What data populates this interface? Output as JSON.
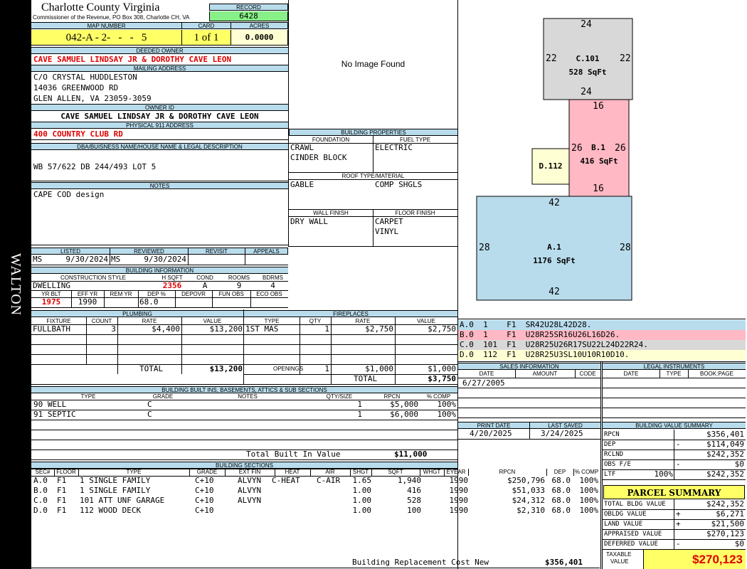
{
  "side_label": "WALTON",
  "header": {
    "county": "Charlotte County Virginia",
    "commissioner": "Commissioner of the Revenue, PO Box 308, Charlotte CH, VA",
    "record_label": "RECORD",
    "record": "6428"
  },
  "parcel": {
    "map_label": "MAP NUMBER",
    "map": "042-A - 2-   -   -   5",
    "card_label": "CARD",
    "card": "1 of 1",
    "acres_label": "ACRES",
    "acres": "0.0000"
  },
  "owner": {
    "deeded_label": "DEEDED OWNER",
    "deeded": "CAVE SAMUEL LINDSAY JR & DOROTHY CAVE LEON",
    "mailing_label": "MAILING ADDRESS",
    "mail1": "C/O CRYSTAL HUDDLESTON",
    "mail2": "14036 GREENWOOD RD",
    "mail3": "GLEN ALLEN, VA 23059-3059",
    "owner_id_label": "OWNER ID",
    "owner_id": "CAVE SAMUEL LINDSAY JR & DOROTHY CAVE LEON",
    "address_label": "PHYSICAL 911 ADDRESS",
    "address": "400 COUNTRY CLUB RD"
  },
  "legal": {
    "label": "DBA/BUISNESS NAME/HOUSE NAME & LEGAL DESCRIPTION",
    "text": "WB 57/622 DB 244/493 LOT 5"
  },
  "notes": {
    "label": "NOTES",
    "text": "CAPE COD design"
  },
  "photo": {
    "text": "No Image Found"
  },
  "bldg_props": {
    "label": "BUILDING PROPERTIES",
    "foundation_label": "FOUNDATION",
    "foundation1": "CRAWL",
    "foundation2": "CINDER BLOCK",
    "fuel_label": "FUEL TYPE",
    "fuel": "ELECTRIC",
    "roof_label": "ROOF TYPE/MATERIAL",
    "roof1": "GABLE",
    "roof2": "COMP SHGLS",
    "wall_label": "WALL FINISH",
    "wall": "DRY WALL",
    "floor_label": "FLOOR FINISH",
    "floor1": "CARPET",
    "floor2": "VINYL"
  },
  "review": {
    "listed_label": "LISTED",
    "listed_by": "MS",
    "listed_date": "9/30/2024",
    "reviewed_label": "REVIEWED",
    "reviewed_by": "MS",
    "reviewed_date": "9/30/2024",
    "revisit_label": "REVISIT",
    "appeals_label": "APPEALS"
  },
  "bldg_info": {
    "label": "BUILDING INFORMATION",
    "style_label": "CONSTRUCTION STYLE",
    "style": "DWELLING",
    "hsqft_label": "H SQFT",
    "hsqft": "2356",
    "cond_label": "COND",
    "cond": "A",
    "rooms_label": "ROOMS",
    "rooms": "9",
    "bdrms_label": "BDRMS",
    "bdrms": "4",
    "yrblt_label": "YR BLT",
    "yrblt": "1975",
    "effyr_label": "EFF YR",
    "effyr": "1990",
    "remyr_label": "REM YR",
    "dep_label": "DEP %",
    "dep": "68.0",
    "depovr_label": "DEPOVR",
    "funobs_label": "FUN OBS",
    "ecoobs_label": "ECO OBS"
  },
  "plumbing": {
    "label": "PLUMBING",
    "cols": [
      "FIXTURE",
      "COUNT",
      "RATE",
      "VALUE"
    ],
    "rows": [
      {
        "fixture": "FULLBATH",
        "count": "3",
        "rate": "$4,400",
        "value": "$13,200"
      }
    ],
    "total_label": "TOTAL",
    "total": "$13,200"
  },
  "fireplaces": {
    "label": "FIREPLACES",
    "cols": [
      "TYPE",
      "QTY",
      "RATE",
      "VALUE"
    ],
    "rows": [
      {
        "type": "1ST MAS",
        "qty": "1",
        "rate": "$2,750",
        "value": "$2,750"
      }
    ],
    "openings_label": "OPENINGS",
    "openings_qty": "1",
    "openings_rate": "$1,000",
    "openings_value": "$1,000",
    "total_label": "TOTAL",
    "total": "$3,750"
  },
  "builtins": {
    "label": "BUILDING BUILT INS, BASEMENTS, ATTICS & SUB SECTIONS",
    "cols": [
      "TYPE",
      "GRADE",
      "NOTES",
      "QTY/SIZE",
      "RPCN",
      "% COMP"
    ],
    "rows": [
      {
        "type": "90 WELL",
        "grade": "C",
        "notes": "",
        "qty": "1",
        "rpcn": "$5,000",
        "comp": "100%"
      },
      {
        "type": "91 SEPTIC",
        "grade": "C",
        "notes": "",
        "qty": "1",
        "rpcn": "$6,000",
        "comp": "100%"
      }
    ],
    "total_label": "Total Built In Value",
    "total": "$11,000"
  },
  "sections": {
    "label": "BUILDING SECTIONS",
    "cols": [
      "SEC#",
      "FLOOR",
      "TYPE",
      "GRADE",
      "EXT FIN",
      "HEAT",
      "AIR",
      "SHGT",
      "SQFT",
      "WHGT",
      "EYEAR",
      "RPCN",
      "DEP",
      "% COMP"
    ],
    "rows": [
      {
        "sec": "A.0",
        "floor": "F1",
        "type": "1 SINGLE FAMILY",
        "grade": "C+10",
        "ext": "ALVYN",
        "heat": "C-HEAT",
        "air": "C-AIR",
        "shgt": "1.65",
        "sqft": "1,940",
        "whgt": "",
        "eyear": "1990",
        "rpcn": "$250,796",
        "dep": "68.0",
        "comp": "100%"
      },
      {
        "sec": "B.0",
        "floor": "F1",
        "type": "1 SINGLE FAMILY",
        "grade": "C+10",
        "ext": "ALVYN",
        "heat": "",
        "air": "",
        "shgt": "1.00",
        "sqft": "416",
        "whgt": "",
        "eyear": "1990",
        "rpcn": "$51,033",
        "dep": "68.0",
        "comp": "100%"
      },
      {
        "sec": "C.0",
        "floor": "F1",
        "type": "101 ATT UNF GARAGE",
        "grade": "C+10",
        "ext": "ALVYN",
        "heat": "",
        "air": "",
        "shgt": "1.00",
        "sqft": "528",
        "whgt": "",
        "eyear": "1990",
        "rpcn": "$24,312",
        "dep": "68.0",
        "comp": "100%"
      },
      {
        "sec": "D.0",
        "floor": "F1",
        "type": "112 WOOD DECK",
        "grade": "C+10",
        "ext": "",
        "heat": "",
        "air": "",
        "shgt": "1.00",
        "sqft": "100",
        "whgt": "",
        "eyear": "1990",
        "rpcn": "$2,310",
        "dep": "68.0",
        "comp": "100%"
      }
    ],
    "brcn_label": "Building Replacement Cost New",
    "brcn": "$356,401"
  },
  "sketch": {
    "c_label": "C.101",
    "c_area": "528 SqFt",
    "c_top": "24",
    "c_bottom": "24",
    "c_left": "22",
    "c_right": "22",
    "b_label": "B.1",
    "b_area": "416 SqFt",
    "b_top": "16",
    "b_bottom": "16",
    "b_left": "26",
    "b_right": "26",
    "d_label": "D.112",
    "a_label": "A.1",
    "a_area": "1176 SqFt",
    "a_top": "42",
    "a_bottom": "42",
    "a_left": "28",
    "a_right": "28"
  },
  "vectors": [
    {
      "text": "A.0  1    F1  SR42U28L42D28.",
      "color": "#b8dcec"
    },
    {
      "text": "B.0  1    F1  U28R25SR16U26L16D26.",
      "color": "#ffb8c4"
    },
    {
      "text": "C.0  101  F1  U28R25U26R17SU22L24D22R24.",
      "color": "#d8d8d8"
    },
    {
      "text": "D.0  112  F1  U28R25U3SL10U10R10D10.",
      "color": "#ffffd4"
    }
  ],
  "sales": {
    "label": "SALES INFORMATION",
    "cols": [
      "DATE",
      "AMOUNT",
      "CODE"
    ],
    "rows": [
      {
        "date": "6/27/2005",
        "amount": "",
        "code": ""
      }
    ]
  },
  "legal_instr": {
    "label": "LEGAL INSTRUMENTS",
    "cols": [
      "DATE",
      "TYPE",
      "BOOK:PAGE"
    ]
  },
  "dates": {
    "print_label": "PRINT DATE",
    "print": "4/20/2025",
    "saved_label": "LAST SAVED",
    "saved": "3/24/2025"
  },
  "value_summary": {
    "label": "BUILDING VALUE SUMMARY",
    "rows": [
      {
        "label": "RPCN",
        "sign": "",
        "value": "$356,401"
      },
      {
        "label": "DEP",
        "sign": "-",
        "value": "$114,049"
      },
      {
        "label": "RCLND",
        "sign": "",
        "value": "$242,352"
      },
      {
        "label": "OBS F/E",
        "sign": "-",
        "value": "$0"
      },
      {
        "label": "LTF",
        "pct": "100%",
        "sign": "",
        "value": "$242,352"
      }
    ]
  },
  "parcel_summary": {
    "label": "PARCEL SUMMARY",
    "rows": [
      {
        "label": "TOTAL BLDG VALUE",
        "sign": "",
        "value": "$242,352"
      },
      {
        "label": "OBLDG VALUE",
        "sign": "+",
        "value": "$6,271"
      },
      {
        "label": "LAND VALUE",
        "sign": "+",
        "value": "$21,500"
      },
      {
        "label": "APPRAISED VALUE",
        "sign": "",
        "value": "$270,123"
      },
      {
        "label": "DEFERRED VALUE",
        "sign": "-",
        "value": "$0"
      }
    ],
    "taxable_label1": "TAXABLE",
    "taxable_label2": "VALUE",
    "taxable": "$270,123"
  }
}
